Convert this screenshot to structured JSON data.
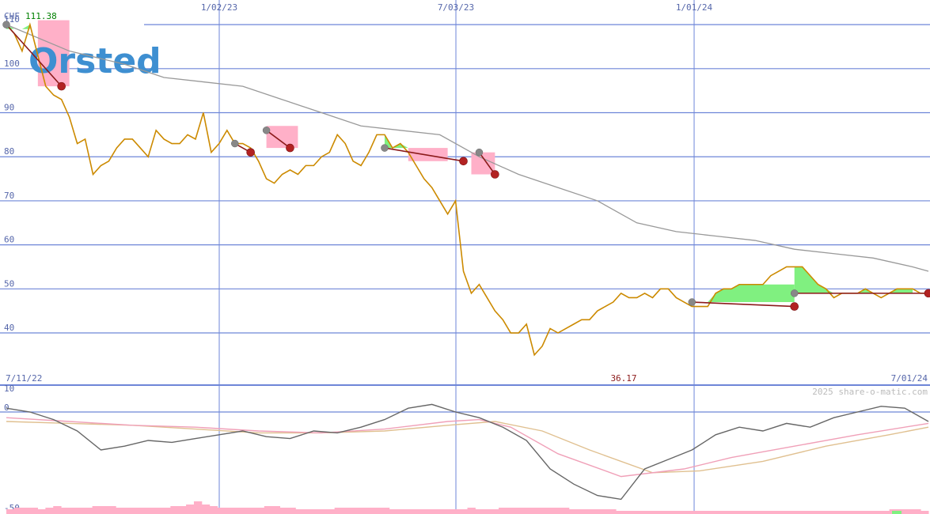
{
  "header": {
    "currency": "CHF",
    "last_value": "111.38",
    "last_value_color": "#008000"
  },
  "logo": {
    "text": "Orsted",
    "color": "#3e8fd1"
  },
  "footer": {
    "low_value": "36.17",
    "credit": "2025 share-o-matic.com"
  },
  "colors": {
    "grid": "#6e86d8",
    "price": "#cc8a00",
    "average": "#999999",
    "trend": "#8b1a1a",
    "gain_fill": "#80f080",
    "loss_fill": "#ffb0c8",
    "marker_start": "#888888",
    "marker_end": "#b22222",
    "osc_main": "#666666",
    "osc_fast": "#f0a0b8",
    "osc_slow": "#e0c090",
    "volume": "#ffb0c8",
    "volume_positive": "#80f080"
  },
  "chart_data": [
    {
      "type": "line",
      "title": "",
      "x_tick_labels": [
        "1/02/23",
        "7/03/23",
        "1/01/24"
      ],
      "x_range_labels": [
        "7/11/22",
        "7/01/24"
      ],
      "ylim": [
        33,
        112
      ],
      "y_ticks": [
        40,
        50,
        60,
        70,
        80,
        90,
        100,
        110
      ],
      "grid": true,
      "series": [
        {
          "role": "price",
          "x": [
            0,
            1,
            2,
            3,
            4,
            5,
            6,
            7,
            8,
            9,
            10,
            11,
            12,
            13,
            14,
            15,
            16,
            17,
            18,
            19,
            20,
            21,
            22,
            23,
            24,
            25,
            26,
            27,
            28,
            29,
            30,
            31,
            32,
            33,
            34,
            35,
            36,
            37,
            38,
            39,
            40,
            41,
            42,
            43,
            44,
            45,
            46,
            47,
            48,
            49,
            50,
            51,
            52,
            53,
            54,
            55,
            56,
            57,
            58,
            59,
            60,
            61,
            62,
            63,
            64,
            65,
            66,
            67,
            68,
            69,
            70,
            71,
            72,
            73,
            74,
            75,
            76,
            77,
            78,
            79,
            80,
            81,
            82,
            83,
            84,
            85,
            86,
            87,
            88,
            89,
            90,
            91,
            92,
            93,
            94,
            95,
            96,
            97,
            98,
            99,
            100,
            101,
            102,
            103,
            104,
            105,
            106,
            107,
            108,
            109,
            110,
            111,
            112,
            113,
            114,
            115,
            116,
            117
          ],
          "values": [
            110,
            108,
            104,
            110,
            103,
            96,
            94,
            93,
            89,
            83,
            84,
            76,
            78,
            79,
            82,
            84,
            84,
            82,
            80,
            86,
            84,
            83,
            83,
            85,
            84,
            90,
            81,
            83,
            86,
            83,
            83,
            82,
            79,
            75,
            74,
            76,
            77,
            76,
            78,
            78,
            80,
            81,
            85,
            83,
            79,
            78,
            81,
            85,
            85,
            82,
            83,
            81,
            78,
            75,
            73,
            70,
            67,
            70,
            54,
            49,
            51,
            48,
            45,
            43,
            40,
            40,
            42,
            35,
            37,
            41,
            40,
            41,
            42,
            43,
            43,
            45,
            46,
            47,
            49,
            48,
            48,
            49,
            48,
            50,
            50,
            48,
            47,
            46,
            46,
            46,
            49,
            50,
            50,
            51,
            51,
            51,
            51,
            53,
            54,
            55,
            55,
            55,
            53,
            51,
            50,
            48,
            49,
            49,
            49,
            50,
            49,
            48,
            49,
            50,
            50,
            50,
            49,
            49
          ]
        },
        {
          "role": "average",
          "x": [
            0,
            8,
            15,
            20,
            25,
            30,
            35,
            40,
            45,
            50,
            55,
            60,
            65,
            70,
            75,
            80,
            85,
            90,
            95,
            100,
            105,
            110,
            115,
            117
          ],
          "values": [
            110,
            104,
            101,
            98,
            97,
            96,
            93,
            90,
            87,
            86,
            85,
            80,
            76,
            73,
            70,
            65,
            63,
            62,
            61,
            59,
            58,
            57,
            55,
            54
          ]
        }
      ],
      "trend_lines": [
        {
          "x": [
            0,
            7
          ],
          "values": [
            110,
            96
          ]
        },
        {
          "x": [
            29,
            31
          ],
          "values": [
            83,
            81
          ]
        },
        {
          "x": [
            33,
            36
          ],
          "values": [
            86,
            82
          ]
        },
        {
          "x": [
            48,
            58
          ],
          "values": [
            82,
            79
          ]
        },
        {
          "x": [
            60,
            62
          ],
          "values": [
            81,
            76
          ]
        },
        {
          "x": [
            87,
            100
          ],
          "values": [
            47,
            46
          ]
        },
        {
          "x": [
            100,
            117
          ],
          "values": [
            49,
            49
          ]
        }
      ],
      "gain_zones": [
        {
          "x": [
            0,
            3
          ],
          "top": 111,
          "bottom": 109
        },
        {
          "x": [
            29,
            31
          ],
          "top": 91,
          "bottom": 83
        },
        {
          "x": [
            48,
            52
          ],
          "top": 86,
          "bottom": 82
        },
        {
          "x": [
            53,
            56
          ],
          "top": 87,
          "bottom": 82
        },
        {
          "x": [
            87,
            100
          ],
          "top": 51,
          "bottom": 47
        },
        {
          "x": [
            100,
            115
          ],
          "top": 55,
          "bottom": 49
        }
      ],
      "loss_zones": [
        {
          "x": [
            4,
            8
          ],
          "top": 111,
          "bottom": 96
        },
        {
          "x": [
            33,
            37
          ],
          "top": 87,
          "bottom": 82
        },
        {
          "x": [
            51,
            56
          ],
          "top": 82,
          "bottom": 79
        },
        {
          "x": [
            59,
            62
          ],
          "top": 81,
          "bottom": 76
        }
      ],
      "low_marker": {
        "x": 67,
        "value": 36.17
      }
    },
    {
      "type": "line",
      "title": "",
      "ylim": [
        -50,
        10
      ],
      "y_ticks": [
        10,
        0,
        -50
      ],
      "series": [
        {
          "role": "oscillator",
          "x": [
            0,
            3,
            6,
            9,
            12,
            15,
            18,
            21,
            24,
            27,
            30,
            33,
            36,
            39,
            42,
            45,
            48,
            51,
            54,
            57,
            60,
            63,
            66,
            69,
            72,
            75,
            78,
            81,
            84,
            87,
            90,
            93,
            96,
            99,
            102,
            105,
            108,
            111,
            114,
            117
          ],
          "values": [
            2,
            0,
            -4,
            -10,
            -20,
            -18,
            -15,
            -16,
            -14,
            -12,
            -10,
            -13,
            -14,
            -10,
            -11,
            -8,
            -4,
            2,
            4,
            0,
            -3,
            -8,
            -15,
            -30,
            -38,
            -44,
            -46,
            -30,
            -25,
            -20,
            -12,
            -8,
            -10,
            -6,
            -8,
            -3,
            0,
            3,
            2,
            -5
          ]
        },
        {
          "role": "fast_average",
          "x": [
            0,
            8,
            16,
            24,
            32,
            40,
            48,
            56,
            60,
            64,
            70,
            78,
            86,
            92,
            100,
            108,
            117
          ],
          "values": [
            -3,
            -5,
            -7,
            -8,
            -10,
            -11,
            -9,
            -5,
            -4,
            -8,
            -22,
            -34,
            -30,
            -24,
            -18,
            -12,
            -6
          ]
        },
        {
          "role": "slow_average",
          "x": [
            0,
            8,
            16,
            24,
            32,
            40,
            48,
            56,
            62,
            68,
            74,
            82,
            88,
            96,
            104,
            112,
            117
          ],
          "values": [
            -5,
            -6,
            -7,
            -9,
            -11,
            -11,
            -10,
            -7,
            -5,
            -10,
            -20,
            -32,
            -31,
            -26,
            -18,
            -12,
            -8
          ]
        }
      ],
      "volume": [
        3,
        4,
        4,
        4,
        3,
        4,
        5,
        4,
        4,
        4,
        4,
        5,
        5,
        5,
        4,
        4,
        4,
        4,
        4,
        4,
        4,
        5,
        5,
        6,
        8,
        6,
        5,
        4,
        4,
        4,
        4,
        4,
        4,
        5,
        5,
        4,
        4,
        3,
        3,
        3,
        3,
        3,
        4,
        4,
        4,
        4,
        4,
        4,
        4,
        3,
        3,
        3,
        3,
        3,
        3,
        3,
        3,
        3,
        3,
        4,
        3,
        3,
        3,
        4,
        4,
        4,
        4,
        4,
        4,
        4,
        4,
        4,
        3,
        3,
        3,
        3,
        3,
        3,
        2,
        2,
        2,
        2,
        2,
        2,
        2,
        2,
        2,
        2,
        2,
        2,
        2,
        2,
        2,
        2,
        2,
        2,
        2,
        2,
        2,
        2,
        2,
        2,
        2,
        2,
        2,
        2,
        2,
        2,
        2,
        2,
        2,
        2,
        2,
        3,
        3,
        3,
        3,
        2
      ]
    }
  ]
}
